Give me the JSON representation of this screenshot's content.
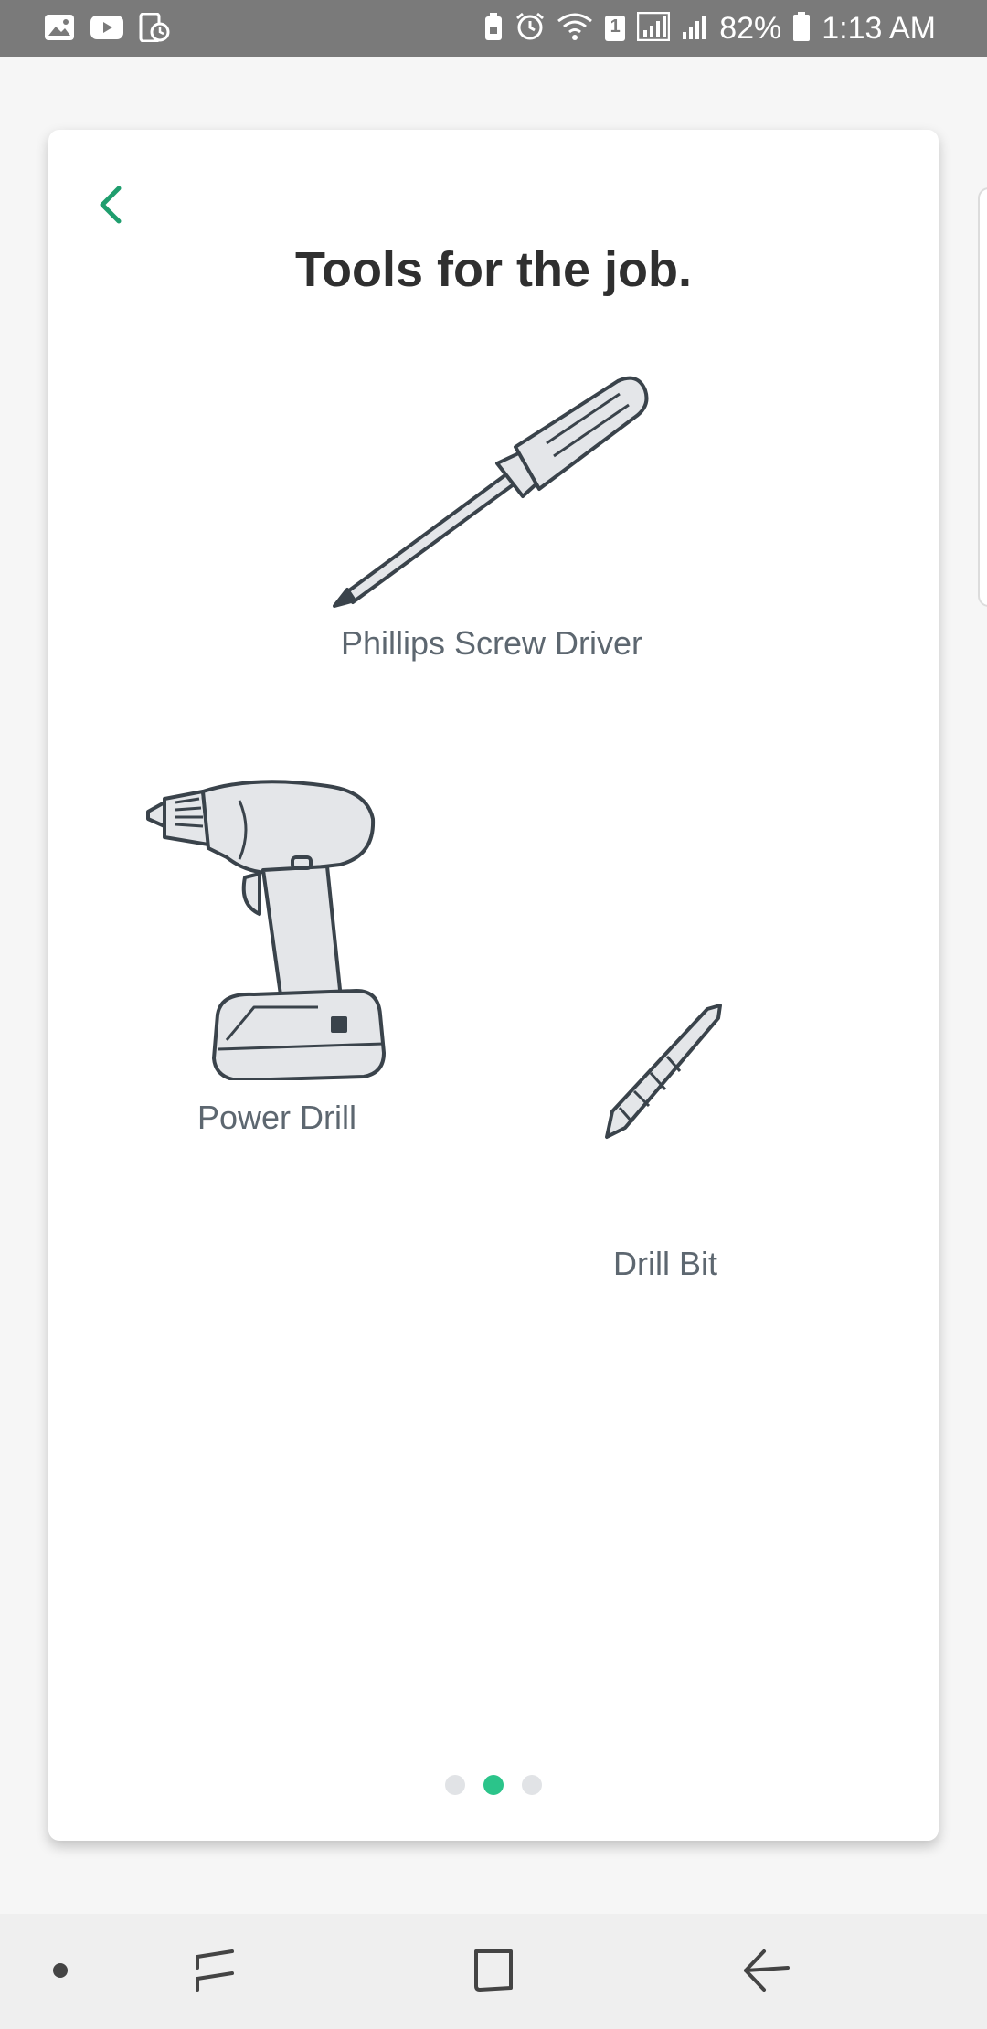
{
  "status_bar": {
    "battery_text": "82%",
    "time": "1:13 AM",
    "sim_badge": "1",
    "left_icons": [
      "gallery-icon",
      "youtube-icon",
      "device-clock-icon"
    ],
    "right_icons": [
      "lock-battery-icon",
      "alarm-icon",
      "wifi-icon",
      "sim-icon",
      "signal-icon",
      "signal-icon",
      "battery-icon"
    ]
  },
  "card": {
    "title": "Tools for the job.",
    "tools": [
      {
        "label": "Phillips Screw Driver",
        "icon": "screwdriver-icon"
      },
      {
        "label": "Power Drill",
        "icon": "power-drill-icon"
      },
      {
        "label": "Drill Bit",
        "icon": "drill-bit-icon"
      }
    ],
    "pagination": {
      "total": 3,
      "current": 2
    }
  },
  "colors": {
    "accent": "#2bc48a",
    "back_arrow": "#1f9e6e",
    "title": "#2f2f2f",
    "label": "#5d6770",
    "status_bar": "#7a7a7a"
  },
  "nav_bar": {
    "buttons": [
      "dot-button",
      "recent-apps-button",
      "home-button",
      "back-button"
    ]
  }
}
